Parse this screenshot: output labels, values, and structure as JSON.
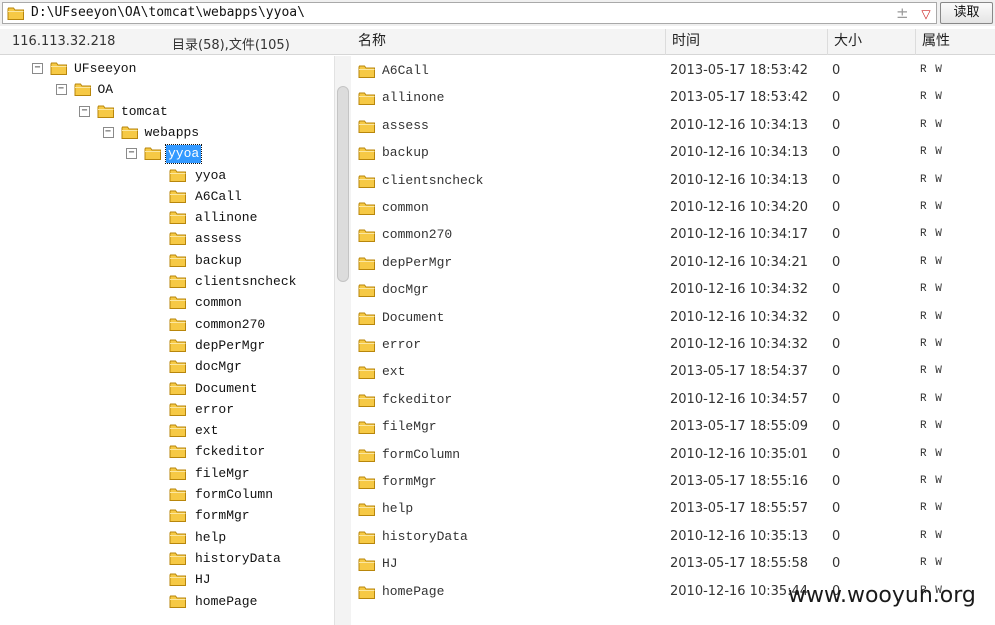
{
  "pathbar": {
    "path": "D:\\UFseeyon\\OA\\tomcat\\webapps\\yyoa\\",
    "plus_glyph": "±",
    "dropdown_glyph": "▽",
    "read_label": "读取"
  },
  "info": {
    "ip": "116.113.32.218",
    "counts": "目录(58),文件(105)"
  },
  "columns": {
    "name": "名称",
    "time": "时间",
    "size": "大小",
    "attr": "属性"
  },
  "tree": {
    "ancestors": [
      {
        "label": "UFseeyon",
        "toggle": "−"
      },
      {
        "label": "OA",
        "toggle": "−"
      },
      {
        "label": "tomcat",
        "toggle": "−"
      },
      {
        "label": "webapps",
        "toggle": "−"
      },
      {
        "label": "yyoa",
        "toggle": "−",
        "selected": true
      }
    ],
    "children": [
      "yyoa",
      "A6Call",
      "allinone",
      "assess",
      "backup",
      "clientsncheck",
      "common",
      "common270",
      "depPerMgr",
      "docMgr",
      "Document",
      "error",
      "ext",
      "fckeditor",
      "fileMgr",
      "formColumn",
      "formMgr",
      "help",
      "historyData",
      "HJ",
      "homePage"
    ]
  },
  "files": [
    {
      "name": "A6Call",
      "time": "2013-05-17 18:53:42",
      "size": "0",
      "attr": "R W"
    },
    {
      "name": "allinone",
      "time": "2013-05-17 18:53:42",
      "size": "0",
      "attr": "R W"
    },
    {
      "name": "assess",
      "time": "2010-12-16 10:34:13",
      "size": "0",
      "attr": "R W"
    },
    {
      "name": "backup",
      "time": "2010-12-16 10:34:13",
      "size": "0",
      "attr": "R W"
    },
    {
      "name": "clientsncheck",
      "time": "2010-12-16 10:34:13",
      "size": "0",
      "attr": "R W"
    },
    {
      "name": "common",
      "time": "2010-12-16 10:34:20",
      "size": "0",
      "attr": "R W"
    },
    {
      "name": "common270",
      "time": "2010-12-16 10:34:17",
      "size": "0",
      "attr": "R W"
    },
    {
      "name": "depPerMgr",
      "time": "2010-12-16 10:34:21",
      "size": "0",
      "attr": "R W"
    },
    {
      "name": "docMgr",
      "time": "2010-12-16 10:34:32",
      "size": "0",
      "attr": "R W"
    },
    {
      "name": "Document",
      "time": "2010-12-16 10:34:32",
      "size": "0",
      "attr": "R W"
    },
    {
      "name": "error",
      "time": "2010-12-16 10:34:32",
      "size": "0",
      "attr": "R W"
    },
    {
      "name": "ext",
      "time": "2013-05-17 18:54:37",
      "size": "0",
      "attr": "R W"
    },
    {
      "name": "fckeditor",
      "time": "2010-12-16 10:34:57",
      "size": "0",
      "attr": "R W"
    },
    {
      "name": "fileMgr",
      "time": "2013-05-17 18:55:09",
      "size": "0",
      "attr": "R W"
    },
    {
      "name": "formColumn",
      "time": "2010-12-16 10:35:01",
      "size": "0",
      "attr": "R W"
    },
    {
      "name": "formMgr",
      "time": "2013-05-17 18:55:16",
      "size": "0",
      "attr": "R W"
    },
    {
      "name": "help",
      "time": "2013-05-17 18:55:57",
      "size": "0",
      "attr": "R W"
    },
    {
      "name": "historyData",
      "time": "2010-12-16 10:35:13",
      "size": "0",
      "attr": "R W"
    },
    {
      "name": "HJ",
      "time": "2013-05-17 18:55:58",
      "size": "0",
      "attr": "R W"
    },
    {
      "name": "homePage",
      "time": "2010-12-16 10:35:44",
      "size": "0",
      "attr": "R W"
    }
  ],
  "watermark": "www.wooyun.org",
  "colors": {
    "folder_fill": "#f6c945",
    "folder_stroke": "#b8860b",
    "selection": "#3399ff"
  }
}
